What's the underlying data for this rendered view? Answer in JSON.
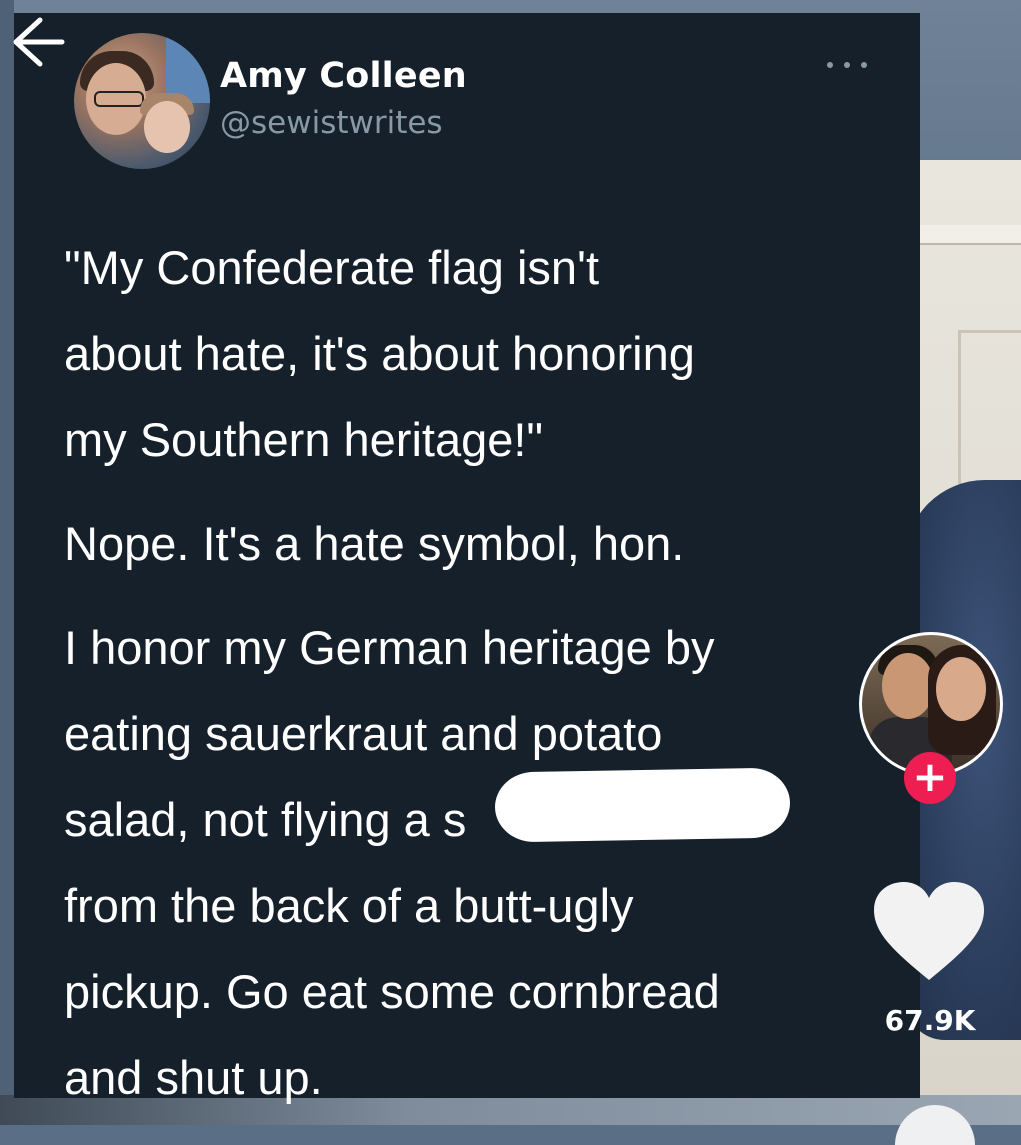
{
  "tweet": {
    "author_name": "Amy Colleen",
    "author_handle": "@sewistwrites",
    "paragraphs": [
      "\"My Confederate flag isn't about hate, it's about honoring my Southern heritage!\"",
      "Nope. It's a hate symbol, hon.",
      "I honor my German heritage by eating sauerkraut and potato salad, not flying a s",
      "from the back of a butt-ugly pickup. Go eat some cornbread and shut up."
    ],
    "lines": [
      "\"My Confederate flag isn't",
      "about hate, it's about honoring",
      "my Southern heritage!\"",
      "Nope. It's a hate symbol, hon.",
      "I honor my German heritage by",
      "eating sauerkraut and potato",
      "salad, not flying a s",
      "from the back of a butt-ugly",
      "pickup. Go eat some cornbread",
      "and shut up."
    ]
  },
  "actions": {
    "like_count": "67.9K",
    "follow_label": "+"
  },
  "icons": {
    "back": "back-arrow-icon",
    "more": "more-options-icon",
    "like": "heart-icon",
    "follow": "plus-icon"
  },
  "colors": {
    "card_background": "#15202b",
    "handle_gray": "#8899a6",
    "follow_red": "#ee1d52"
  }
}
